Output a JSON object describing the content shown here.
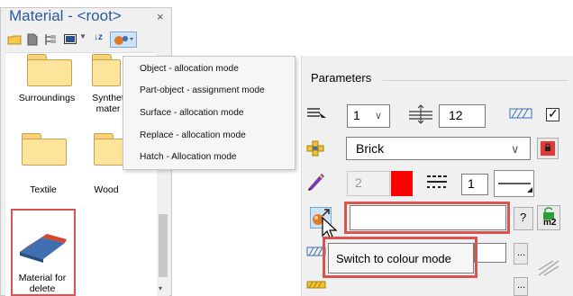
{
  "material_panel": {
    "title": "Material - <root>",
    "close": "×",
    "toolbar_icons": [
      "open-folder-icon",
      "new-item-icon",
      "tree-icon",
      "display-icon",
      "chevron-down-icon",
      "sort-icon",
      "color-mode-icon",
      "chevron-down-icon"
    ],
    "folders": [
      {
        "label": "Surroundings"
      },
      {
        "label": "Synthet mater"
      },
      {
        "label": "Textile"
      },
      {
        "label": "Wood"
      }
    ],
    "material_item": {
      "label_line1": "Material for",
      "label_line2": "delete"
    }
  },
  "dropdown_menu": {
    "items": [
      "Object - allocation mode",
      "Part-object - assignment mode",
      "Surface - allocation mode",
      "Replace - allocation mode",
      "Hatch - Allocation mode"
    ]
  },
  "parameters": {
    "title": "Parameters",
    "row1": {
      "layer_value": "1",
      "spacing_value": "12",
      "checkbox_checked": true
    },
    "row2": {
      "material_value": "Brick"
    },
    "row3": {
      "pen_value": "2",
      "pen_color": "#ff0000",
      "line_value": "1"
    },
    "row4": {
      "colour_input": "",
      "help_label": "?",
      "area_label": "m2"
    },
    "tooltip": "Switch to colour mode",
    "accent_color": "#d9534f"
  }
}
